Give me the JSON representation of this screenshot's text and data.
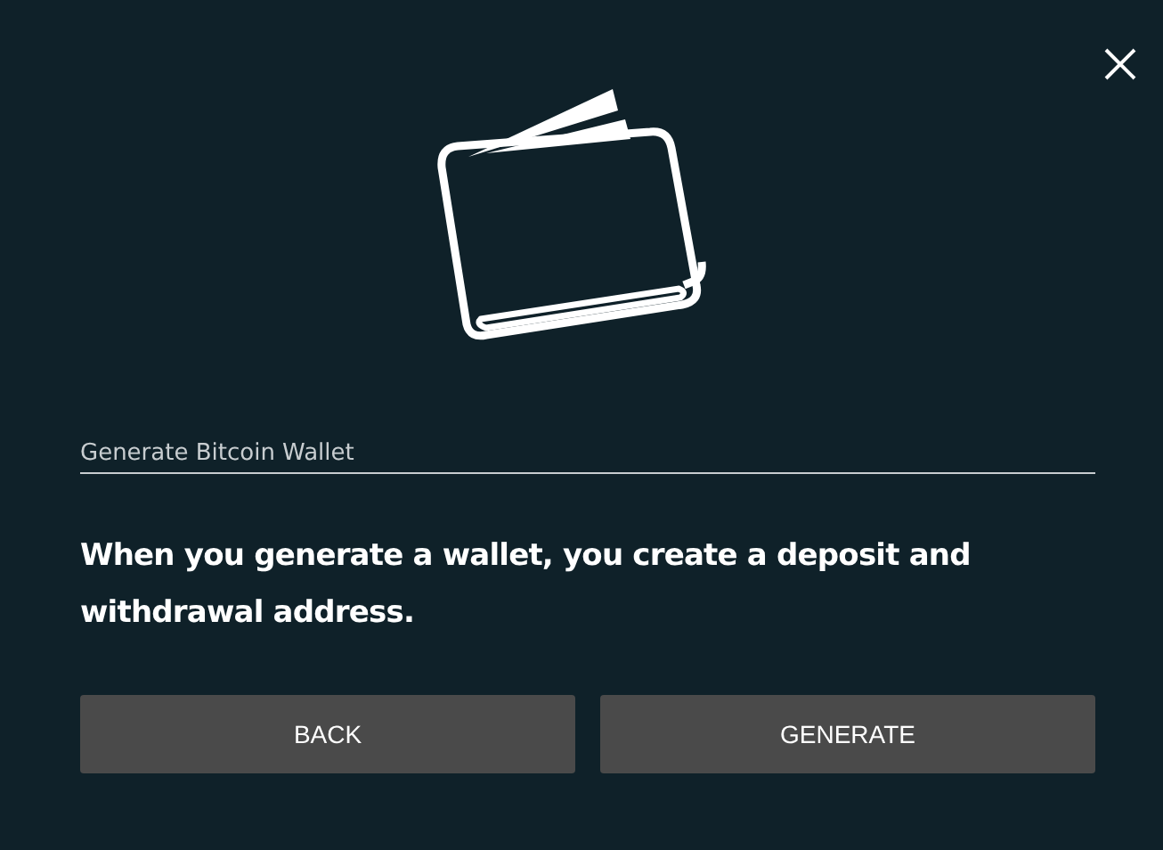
{
  "dialog": {
    "title": "Generate Bitcoin Wallet",
    "message": "When you generate a wallet, you create a deposit and withdrawal address.",
    "buttons": [
      "BACK",
      "GENERATE"
    ]
  }
}
